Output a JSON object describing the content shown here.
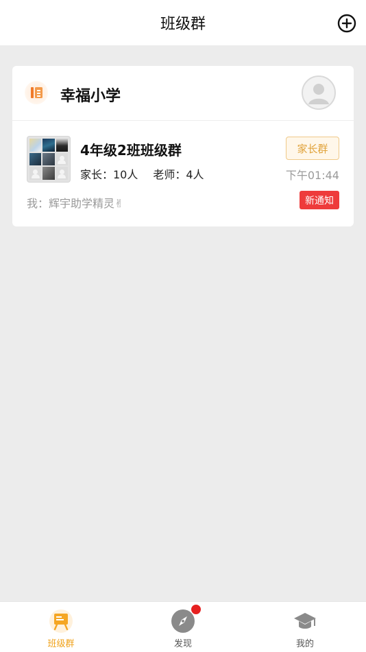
{
  "header": {
    "title": "班级群",
    "add_icon": "plus-circle-icon"
  },
  "school": {
    "name": "幸福小学",
    "logo_icon": "school-logo-icon",
    "avatar_icon": "default-user-avatar-icon"
  },
  "group": {
    "name": "4年级2班班级群",
    "parents_count": "家长：10人",
    "teachers_count": "老师：4人",
    "tag": "家长群",
    "time": "下午01:44",
    "last_message": "我：辉宇助学精灵✌",
    "badge": "新通知"
  },
  "tabbar": {
    "items": [
      {
        "label": "班级群",
        "icon": "class-board-icon",
        "active": true
      },
      {
        "label": "发现",
        "icon": "compass-icon",
        "active": false,
        "has_dot": true
      },
      {
        "label": "我的",
        "icon": "graduation-cap-icon",
        "active": false
      }
    ]
  },
  "colors": {
    "accent": "#f0a21a",
    "badge_red": "#ee3b3b",
    "tag_border": "#f0c988",
    "background": "#ececec"
  }
}
